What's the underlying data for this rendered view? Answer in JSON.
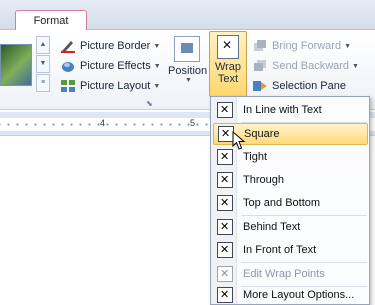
{
  "tabs": {
    "active": "Format"
  },
  "styles_group": {
    "commands": [
      {
        "label": "Picture Border",
        "icon": "picture-border-icon"
      },
      {
        "label": "Picture Effects",
        "icon": "picture-effects-icon"
      },
      {
        "label": "Picture Layout",
        "icon": "picture-layout-icon"
      }
    ]
  },
  "arrange_group": {
    "position_label": "Position",
    "wrap_text_label_1": "Wrap",
    "wrap_text_label_2": "Text",
    "commands": [
      {
        "label": "Bring Forward",
        "disabled": true
      },
      {
        "label": "Send Backward",
        "disabled": true
      },
      {
        "label": "Selection Pane",
        "disabled": false
      }
    ]
  },
  "ruler": {
    "numbers": [
      "4",
      "5"
    ]
  },
  "wrap_menu": {
    "items": [
      {
        "label": "In Line with Text",
        "icon": "inline-wrap-icon"
      },
      {
        "label": "Square",
        "icon": "square-wrap-icon",
        "highlighted": true
      },
      {
        "label": "Tight",
        "icon": "tight-wrap-icon"
      },
      {
        "label": "Through",
        "icon": "through-wrap-icon"
      },
      {
        "label": "Top and Bottom",
        "icon": "top-bottom-wrap-icon"
      },
      {
        "label": "Behind Text",
        "icon": "behind-text-icon"
      },
      {
        "label": "In Front of Text",
        "icon": "in-front-text-icon"
      },
      {
        "label": "Edit Wrap Points",
        "icon": "edit-wrap-points-icon",
        "disabled": true
      },
      {
        "label": "More Layout Options...",
        "icon": "layout-options-icon"
      }
    ]
  },
  "colors": {
    "highlight": "#ffd97a",
    "tab_border": "#d97aa0",
    "ribbon_bg": "#eef2f8"
  }
}
